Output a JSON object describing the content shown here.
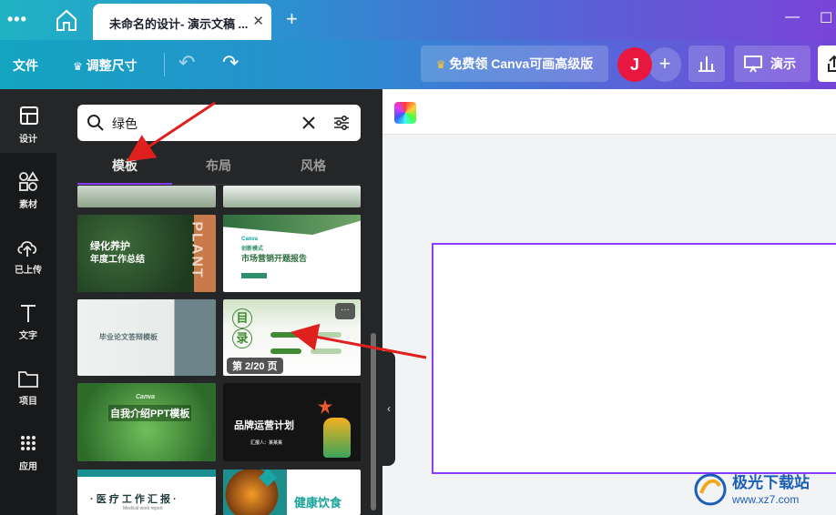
{
  "tabbar": {
    "menu_glyph": "•••",
    "tab_title": "未命名的设计- 演示文稿 ...",
    "tab_close": "✕",
    "new_tab": "+",
    "minimize": "—",
    "maximize": "☐"
  },
  "toolbar": {
    "file_label": "文件",
    "resize_label": "调整尺寸",
    "crown_icon": "crown-icon",
    "undo": "↶",
    "redo": "↷",
    "premium_label": "免费领 Canva可画高级版",
    "avatar_initial": "J",
    "add_glyph": "+",
    "present_label": "演示"
  },
  "rail": {
    "items": [
      {
        "label": "设计",
        "icon": "layout-icon"
      },
      {
        "label": "素材",
        "icon": "shapes-icon"
      },
      {
        "label": "已上传",
        "icon": "cloud-upload-icon"
      },
      {
        "label": "文字",
        "icon": "text-icon"
      },
      {
        "label": "项目",
        "icon": "folder-icon"
      },
      {
        "label": "应用",
        "icon": "apps-grid-icon"
      }
    ]
  },
  "panel": {
    "search_value": "绿色",
    "tabs": [
      "模板",
      "布局",
      "风格"
    ],
    "active_tab": "模板",
    "templates": {
      "t1_line1": "绿化养护",
      "t1_line2": "年度工作总结",
      "t1_vertical": "PLANT",
      "t2_brand": "Canva",
      "t2_sub": "创新模式",
      "t2_title": "市场营销开题报告",
      "t3_title": "毕业论文答辩模板",
      "t4_mu": "目",
      "t4_lu": "录",
      "t4_badge": "第 2/20 页",
      "t4_more": "···",
      "t5_brand": "Canva",
      "t5_title": "自我介绍PPT模板",
      "t6_title": "品牌运营计划",
      "t6_sub": "汇报人：某某某",
      "t7_title": "· 医 疗 工 作 汇 报 ·",
      "t7_sub": "Medical work report",
      "t8_title": "健康饮食"
    }
  },
  "canvas": {
    "collapse_glyph": "‹"
  },
  "watermark": {
    "text": "极光下载站",
    "url": "www.xz7.com"
  },
  "colors": {
    "accent": "#8b3dff",
    "annotation_arrow": "#e0201e",
    "avatar": "#e8173f"
  }
}
